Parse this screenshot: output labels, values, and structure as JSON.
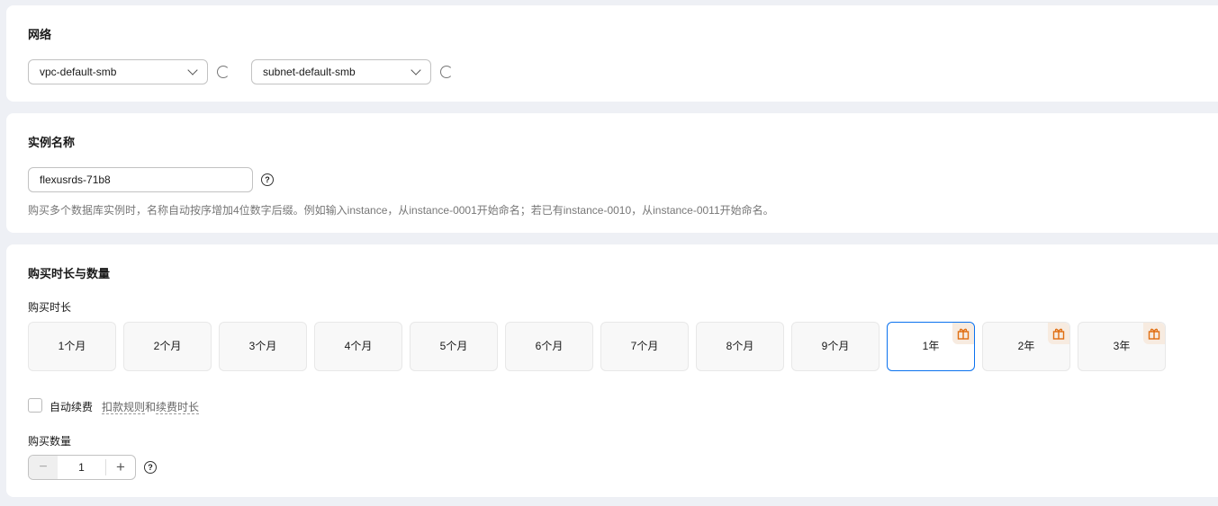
{
  "network": {
    "title": "网络",
    "vpc": "vpc-default-smb",
    "subnet": "subnet-default-smb"
  },
  "instance": {
    "title": "实例名称",
    "value": "flexusrds-71b8",
    "help": "?",
    "hint": "购买多个数据库实例时，名称自动按序增加4位数字后缀。例如输入instance，从instance-0001开始命名；若已有instance-0010，从instance-0011开始命名。"
  },
  "purchase": {
    "title": "购买时长与数量",
    "duration_label": "购买时长",
    "durations": [
      "1个月",
      "2个月",
      "3个月",
      "4个月",
      "5个月",
      "6个月",
      "7个月",
      "8个月",
      "9个月",
      "1年",
      "2年",
      "3年"
    ],
    "selected": "1年",
    "auto_renew": "自动续费",
    "link1": "扣款规则",
    "and": "和",
    "link2": "续费时长",
    "quantity_label": "购买数量",
    "quantity": "1",
    "minus": "−",
    "plus": "+",
    "help": "?"
  },
  "colors": {
    "accent": "#0b72ef",
    "gift": "#e06d10"
  }
}
